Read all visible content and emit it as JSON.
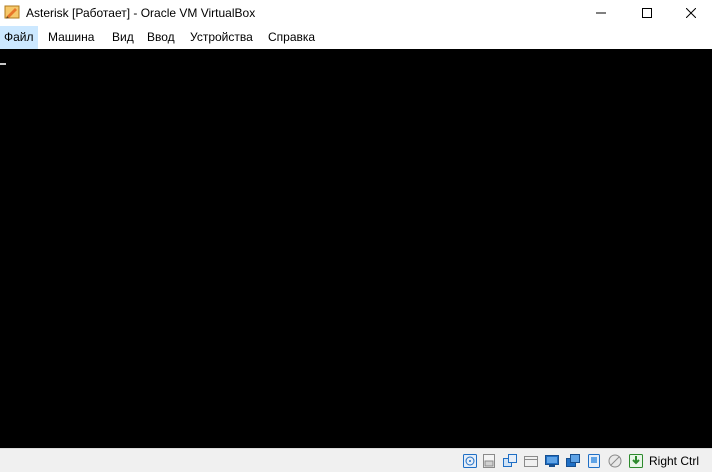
{
  "window": {
    "title": "Asterisk [Работает] - Oracle VM VirtualBox",
    "app_icon": "virtualbox-vm-icon"
  },
  "controls": {
    "minimize_icon": "minimize-icon",
    "maximize_icon": "maximize-icon",
    "close_icon": "close-icon"
  },
  "menu": {
    "items": [
      {
        "label": "Файл",
        "active": true
      },
      {
        "label": "Машина"
      },
      {
        "label": "Вид"
      },
      {
        "label": "Ввод"
      },
      {
        "label": "Устройства"
      },
      {
        "label": "Справка"
      }
    ]
  },
  "screen": {
    "background": "#000000"
  },
  "statusbar": {
    "icons": [
      "hard-disk-icon",
      "optical-drive-icon",
      "audio-icon",
      "network-icon",
      "usb-icon",
      "shared-folders-icon",
      "display-icon",
      "video-capture-icon",
      "cpu-icon",
      "mouse-integration-icon",
      "keyboard-capture-icon"
    ],
    "host_key": "Right Ctrl"
  },
  "colors": {
    "menu_active": "#cce8ff",
    "statusbar_bg": "#f0f0f0",
    "accent_blue": "#1f6fc5"
  }
}
